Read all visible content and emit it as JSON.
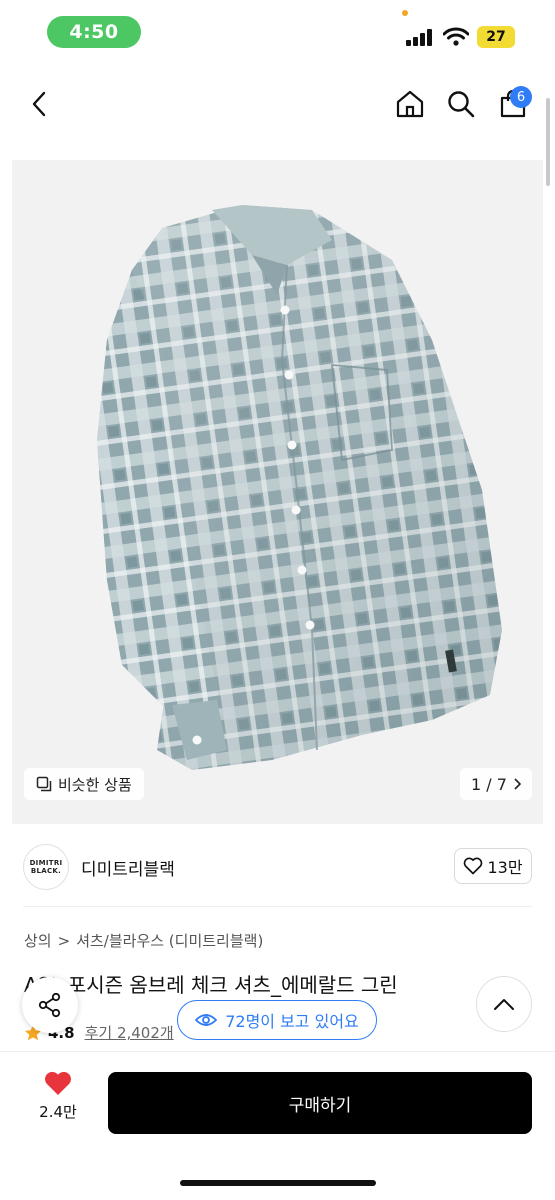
{
  "status_bar": {
    "time": "4:50",
    "battery": "27"
  },
  "nav": {
    "cart_badge": "6"
  },
  "gallery": {
    "similar_label": "비슷한 상품",
    "page_counter": "1 / 7"
  },
  "brand": {
    "logo_line1": "DIMITRI",
    "logo_line2": "BLACK.",
    "name": "디미트리블랙",
    "like_count": "13만"
  },
  "product": {
    "breadcrumb": [
      "상의",
      "셔츠/블라우스 (디미트리블랙)"
    ],
    "title": "ASL 포시즌 옴브레 체크 셔츠_에메랄드 그린",
    "rating": "4.8",
    "reviews": "후기 2,402개"
  },
  "floating": {
    "viewers": "72명이 보고 있어요"
  },
  "bottom_bar": {
    "wish_count": "2.4만",
    "buy_label": "구매하기"
  },
  "colors": {
    "status_green": "#4cc764",
    "accent_blue": "#2f7cf6",
    "heart_red": "#e8343d",
    "star_orange": "#f5a623"
  }
}
